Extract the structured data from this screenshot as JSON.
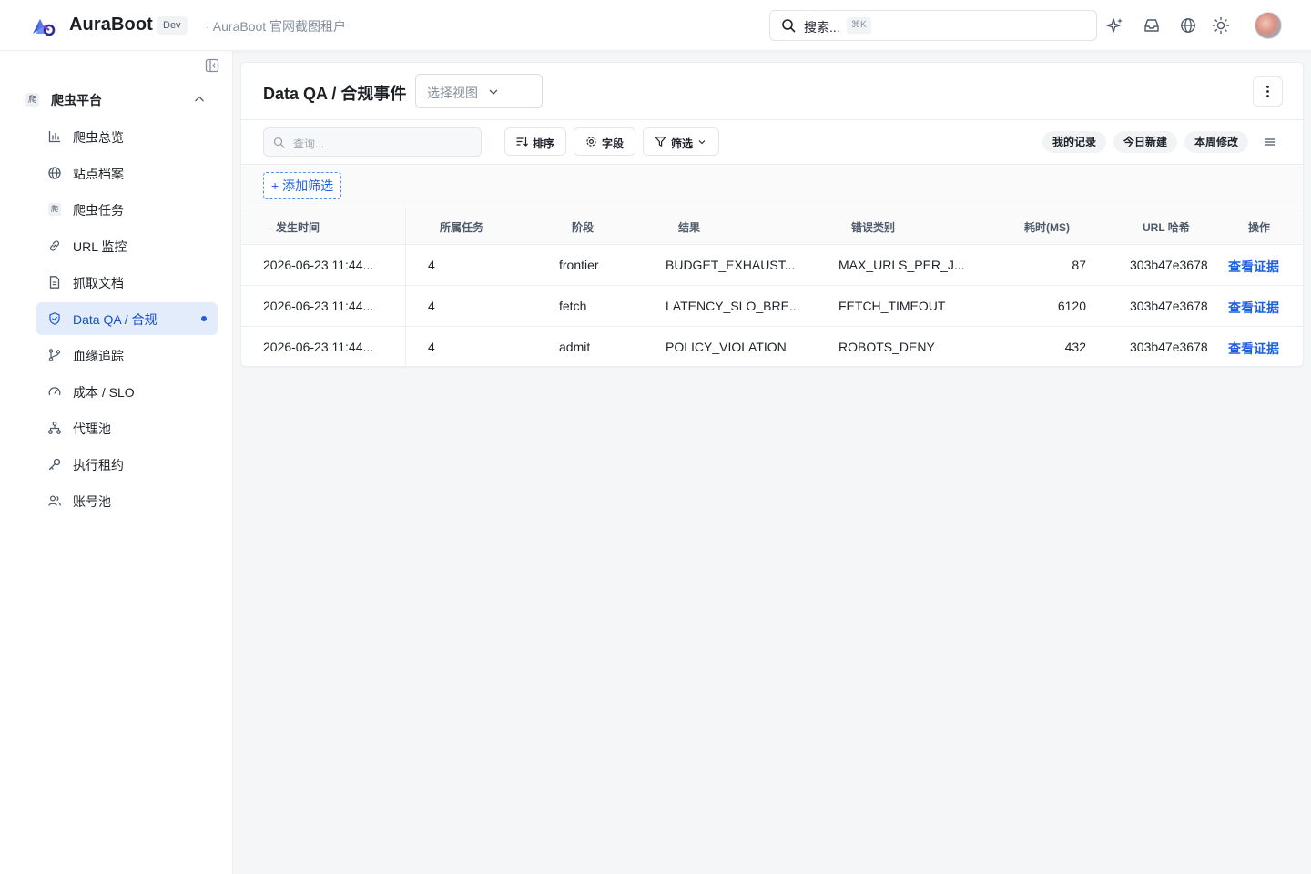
{
  "header": {
    "brand": "AuraBoot",
    "env_badge": "Dev",
    "tenant": "· AuraBoot 官网截图租户",
    "search_placeholder": "搜索...",
    "search_shortcut": "⌘K"
  },
  "sidebar": {
    "group_label": "爬虫平台",
    "group_icon_text": "爬",
    "items": [
      {
        "label": "爬虫总览",
        "icon": "bar-chart-icon"
      },
      {
        "label": "站点档案",
        "icon": "globe-icon"
      },
      {
        "label": "爬虫任务",
        "icon": "crawler-text-icon",
        "icon_text": "爬"
      },
      {
        "label": "URL 监控",
        "icon": "link-icon"
      },
      {
        "label": "抓取文档",
        "icon": "document-icon"
      },
      {
        "label": "Data QA / 合规",
        "icon": "shield-icon",
        "active": true
      },
      {
        "label": "血缘追踪",
        "icon": "git-branch-icon"
      },
      {
        "label": "成本 / SLO",
        "icon": "gauge-icon"
      },
      {
        "label": "代理池",
        "icon": "network-icon"
      },
      {
        "label": "执行租约",
        "icon": "key-icon"
      },
      {
        "label": "账号池",
        "icon": "users-icon"
      }
    ]
  },
  "main": {
    "title": "Data QA / 合规事件",
    "view_select_placeholder": "选择视图",
    "query_placeholder": "查询...",
    "toolbar": {
      "sort": "排序",
      "fields": "字段",
      "filter": "筛选",
      "my_records": "我的记录",
      "today_new": "今日新建",
      "week_modified": "本周修改"
    },
    "add_filter": "+ 添加筛选",
    "table": {
      "columns": [
        "发生时间",
        "所属任务",
        "阶段",
        "结果",
        "错误类别",
        "耗时(MS)",
        "URL 哈希",
        "操作"
      ],
      "rows": [
        {
          "time": "2026-06-23 11:44...",
          "task": "4",
          "stage": "frontier",
          "result": "BUDGET_EXHAUST...",
          "error": "MAX_URLS_PER_J...",
          "duration": "87",
          "hash": "303b47e3678",
          "action": "查看证据"
        },
        {
          "time": "2026-06-23 11:44...",
          "task": "4",
          "stage": "fetch",
          "result": "LATENCY_SLO_BRE...",
          "error": "FETCH_TIMEOUT",
          "duration": "6120",
          "hash": "303b47e3678",
          "action": "查看证据"
        },
        {
          "time": "2026-06-23 11:44...",
          "task": "4",
          "stage": "admit",
          "result": "POLICY_VIOLATION",
          "error": "ROBOTS_DENY",
          "duration": "432",
          "hash": "303b47e3678",
          "action": "查看证据"
        }
      ]
    }
  },
  "colors": {
    "accent": "#1d5fe0",
    "active_bg": "#e3ecfb",
    "page_bg": "#f5f6f7"
  }
}
